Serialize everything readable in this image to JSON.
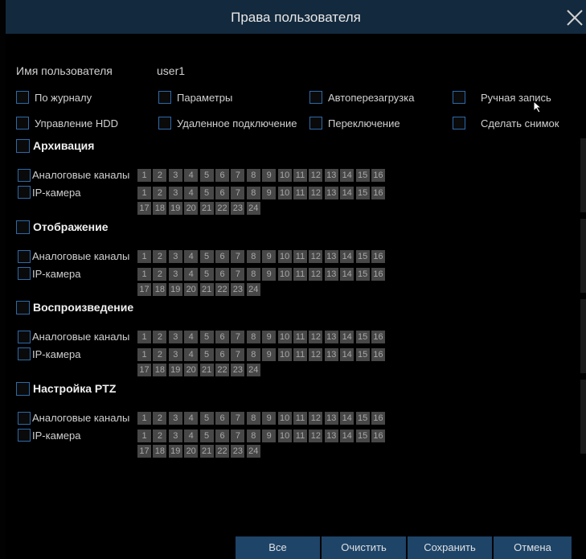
{
  "window": {
    "title": "Права пользователя",
    "close_icon": "close-icon"
  },
  "user": {
    "label": "Имя пользователя",
    "value": "user1"
  },
  "permissions": [
    {
      "label": "По журналу"
    },
    {
      "label": "Параметры"
    },
    {
      "label": "Автоперезагрузка"
    },
    {
      "label": "Ручная запись"
    },
    {
      "label": "Управление HDD"
    },
    {
      "label": "Удаленное подключение"
    },
    {
      "label": "Переключение"
    },
    {
      "label": "Сделать снимок"
    }
  ],
  "sections": [
    {
      "title": "Архивация"
    },
    {
      "title": "Отображение"
    },
    {
      "title": "Воспроизведение"
    },
    {
      "title": "Настройка PTZ"
    }
  ],
  "rows": {
    "analog": "Аналоговые каналы",
    "ip": "IP-камера"
  },
  "channels": [
    "1",
    "2",
    "3",
    "4",
    "5",
    "6",
    "7",
    "8",
    "9",
    "10",
    "11",
    "12",
    "13",
    "14",
    "15",
    "16",
    "17",
    "18",
    "19",
    "20",
    "21",
    "22",
    "23",
    "24"
  ],
  "buttons": {
    "all": "Все",
    "clear": "Очистить",
    "save": "Сохранить",
    "cancel": "Отмена"
  },
  "colors": {
    "titlebar": "#13293d",
    "button": "#1e4468",
    "checkbox_border": "#2d6aa8",
    "channel_bg": "#474747"
  }
}
